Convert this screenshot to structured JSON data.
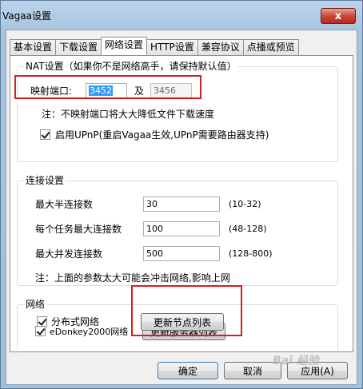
{
  "window": {
    "title": "Vagaa设置",
    "close_label": "x"
  },
  "tabs": [
    {
      "label": "基本设置"
    },
    {
      "label": "下载设置"
    },
    {
      "label": "网络设置",
      "active": true
    },
    {
      "label": "HTTP设置"
    },
    {
      "label": "兼容协议"
    },
    {
      "label": "点播或预览"
    }
  ],
  "nat": {
    "legend": "NAT设置（如果你不是网络高手，请保持默认值）",
    "port_label": "映射端口:",
    "port_value": "3452",
    "and_label": "及",
    "port2_value": "3456",
    "note": "注：不映射端口将大大降低文件下载速度",
    "upnp_label": "启用UPnP(重启Vagaa生效,UPnP需要路由器支持)",
    "upnp_checked": true
  },
  "connection": {
    "legend": "连接设置",
    "rows": [
      {
        "label": "最大半连接数",
        "value": "30",
        "range": "(10-32)"
      },
      {
        "label": "每个任务最大连接数",
        "value": "100",
        "range": "(48-128)"
      },
      {
        "label": "最大并发连接数",
        "value": "500",
        "range": "(128-800)"
      }
    ],
    "note": "注：上面的参数太大可能会冲击网络,影响上网"
  },
  "network": {
    "legend": "网络",
    "edonkey_label": "eDonkey2000网络",
    "edonkey_checked": true,
    "update_servers_label": "更新服务器列表",
    "distributed_label": "分布式网络",
    "distributed_checked": true,
    "update_nodes_label": "更新节点列表"
  },
  "footer": {
    "ok_label": "确定",
    "cancel_label": "取消",
    "apply_label": "应用(A)"
  },
  "colors": {
    "highlight": "#d42020",
    "selection": "#3399ff"
  },
  "watermark": "Bai 经验"
}
